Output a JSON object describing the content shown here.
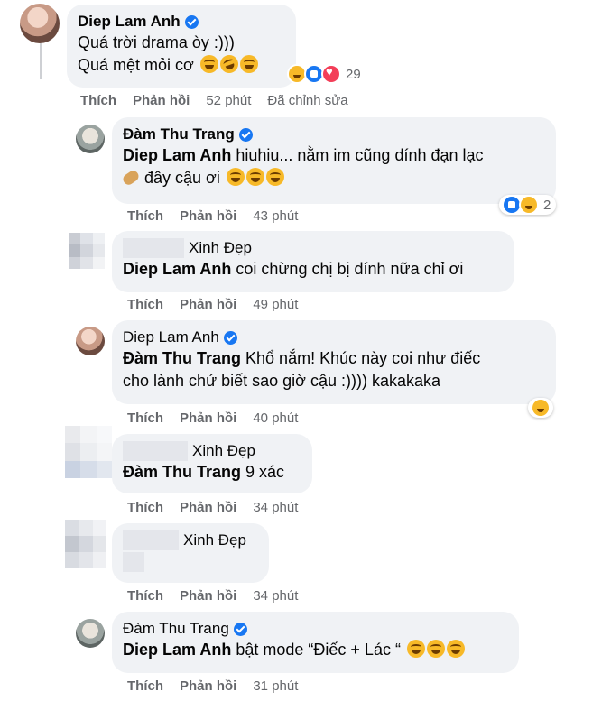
{
  "comments": [
    {
      "name": "Diep Lam Anh",
      "verified": true,
      "lines": [
        "Quá trời drama òy :)))",
        "Quá mệt mỏi cơ"
      ],
      "reactions": {
        "icons": [
          "haha-icon",
          "like-icon",
          "love-icon"
        ],
        "count": "29"
      },
      "actions": {
        "like": "Thích",
        "reply": "Phản hồi",
        "time": "52 phút",
        "edited": "Đã chỉnh sửa"
      }
    },
    {
      "name": "Đàm Thu Trang",
      "verified": true,
      "mention": "Diep Lam Anh",
      "text": "hiuhiu... nằm im cũng dính đạn lạc",
      "text2": "đây cậu ơi",
      "reactions": {
        "icons": [
          "like-icon",
          "haha-icon"
        ],
        "count": "2"
      },
      "actions": {
        "like": "Thích",
        "reply": "Phản hồi",
        "time": "43 phút"
      }
    },
    {
      "name": "Xinh Đẹp",
      "mention": "Diep Lam Anh",
      "text": "coi chừng chị bị dính nữa chỉ ơi",
      "actions": {
        "like": "Thích",
        "reply": "Phản hồi",
        "time": "49 phút"
      }
    },
    {
      "name": "Diep Lam Anh",
      "verified": true,
      "mention": "Đàm Thu Trang",
      "text": "Khổ nắm! Khúc này coi như điếc",
      "text2": "cho lành chứ biết sao giờ cậu :)))) kakakaka",
      "reactions": {
        "icons": [
          "haha-icon"
        ]
      },
      "actions": {
        "like": "Thích",
        "reply": "Phản hồi",
        "time": "40 phút"
      }
    },
    {
      "name": "Xinh Đẹp",
      "mention": "Đàm Thu Trang",
      "text": "9 xác",
      "actions": {
        "like": "Thích",
        "reply": "Phản hồi",
        "time": "34 phút"
      }
    },
    {
      "name": "Xinh Đẹp",
      "actions": {
        "like": "Thích",
        "reply": "Phản hồi",
        "time": "34 phút"
      }
    },
    {
      "name": "Đàm Thu Trang",
      "verified": true,
      "mention": "Diep Lam Anh",
      "text": "bật mode “Điếc + Lác “",
      "actions": {
        "like": "Thích",
        "reply": "Phản hồi",
        "time": "31 phút"
      }
    }
  ]
}
